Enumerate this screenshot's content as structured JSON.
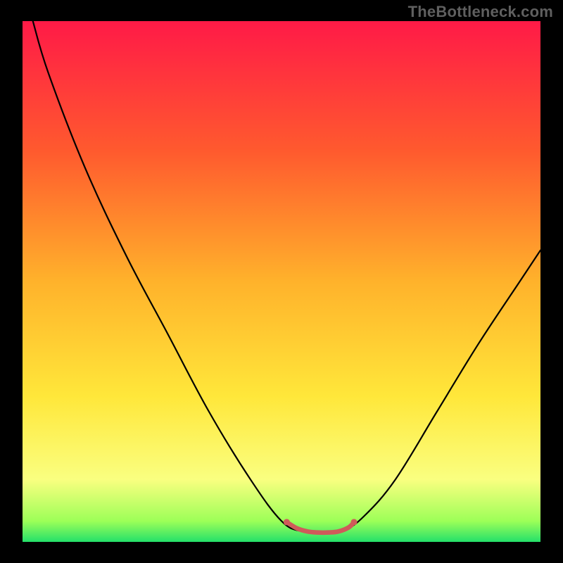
{
  "watermark": "TheBottleneck.com",
  "colors": {
    "background": "#000000",
    "watermark": "#5f5f5f",
    "line_primary": "#000000",
    "highlight": "#cf5a5a"
  },
  "chart_data": {
    "type": "line",
    "title": "",
    "xlabel": "",
    "ylabel": "",
    "xlim": [
      0,
      100
    ],
    "ylim": [
      0,
      100
    ],
    "gradient_stops": [
      {
        "offset": 0,
        "color": "#ff1a47"
      },
      {
        "offset": 25,
        "color": "#ff5a2e"
      },
      {
        "offset": 50,
        "color": "#ffb22b"
      },
      {
        "offset": 72,
        "color": "#ffe73a"
      },
      {
        "offset": 88,
        "color": "#faff80"
      },
      {
        "offset": 96,
        "color": "#9dff58"
      },
      {
        "offset": 100,
        "color": "#24e06a"
      }
    ],
    "series": [
      {
        "name": "bottleneck-curve",
        "color": "#000000",
        "width": 2.2,
        "points": [
          {
            "x": 2,
            "y": 100
          },
          {
            "x": 5,
            "y": 90
          },
          {
            "x": 12,
            "y": 72
          },
          {
            "x": 20,
            "y": 55
          },
          {
            "x": 28,
            "y": 40
          },
          {
            "x": 36,
            "y": 25
          },
          {
            "x": 44,
            "y": 12
          },
          {
            "x": 50,
            "y": 4
          },
          {
            "x": 54,
            "y": 2
          },
          {
            "x": 58,
            "y": 1.8
          },
          {
            "x": 62,
            "y": 2.2
          },
          {
            "x": 66,
            "y": 5
          },
          {
            "x": 72,
            "y": 12
          },
          {
            "x": 80,
            "y": 25
          },
          {
            "x": 88,
            "y": 38
          },
          {
            "x": 96,
            "y": 50
          },
          {
            "x": 100,
            "y": 56
          }
        ]
      },
      {
        "name": "optimal-range",
        "color": "#cf5a5a",
        "width": 6.5,
        "points": [
          {
            "x": 51,
            "y": 3.8
          },
          {
            "x": 53,
            "y": 2.6
          },
          {
            "x": 55,
            "y": 2.0
          },
          {
            "x": 57,
            "y": 1.8
          },
          {
            "x": 59,
            "y": 1.8
          },
          {
            "x": 61,
            "y": 2.0
          },
          {
            "x": 63,
            "y": 2.8
          },
          {
            "x": 64,
            "y": 3.8
          }
        ]
      }
    ]
  }
}
